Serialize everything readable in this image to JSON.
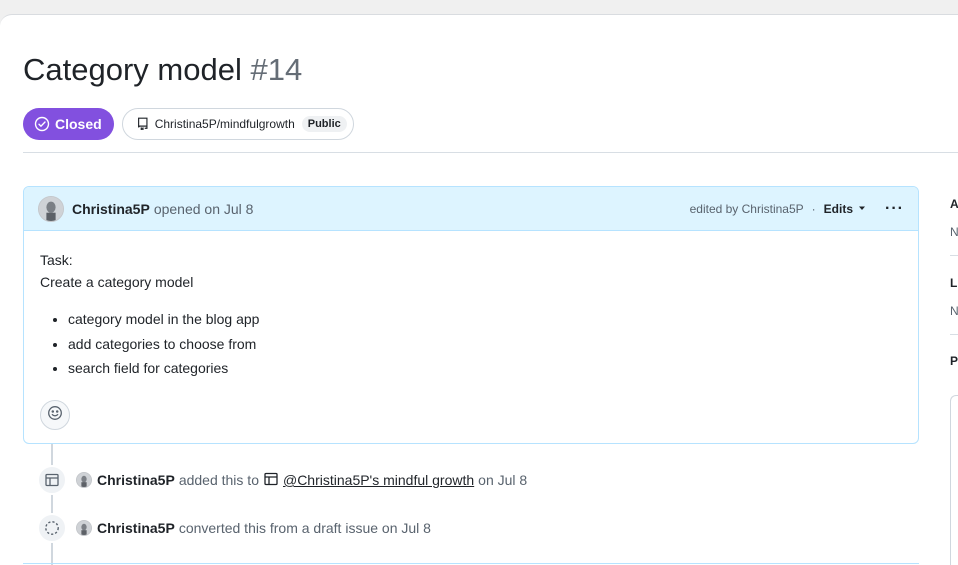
{
  "issue": {
    "title": "Category model",
    "number": "#14",
    "state_label": "Closed",
    "repo": "Christina5P/mindfulgrowth",
    "visibility": "Public"
  },
  "comment": {
    "author": "Christina5P",
    "action": "opened on Jul 8",
    "edited_by": "edited by Christina5P",
    "separator": "·",
    "edits_label": "Edits",
    "more_label": "···",
    "body_line1": "Task:",
    "body_line2": "Create a category model",
    "items": [
      "category model in the blog app",
      "add categories to choose from",
      "search field for categories"
    ]
  },
  "events": [
    {
      "actor": "Christina5P",
      "action": "added this to",
      "project": "@Christina5P's mindful growth",
      "date": "on Jul 8"
    },
    {
      "actor": "Christina5P",
      "action": "converted this from a draft issue on Jul 8"
    }
  ],
  "sidebar": {
    "assignees_initial": "A",
    "assignees_value_initial": "N",
    "labels_initial": "L",
    "labels_value_initial": "N",
    "projects_initial": "P"
  },
  "colors": {
    "closed": "#8250df",
    "comment_header": "#ddf4ff",
    "comment_border": "#b6e3ff"
  },
  "icons": {
    "state": "check-circle-icon",
    "repo": "repo-icon",
    "edits_dropdown": "triangle-down-icon",
    "reaction": "smiley-icon",
    "project_event": "table-icon",
    "draft_event": "issue-draft-icon"
  }
}
